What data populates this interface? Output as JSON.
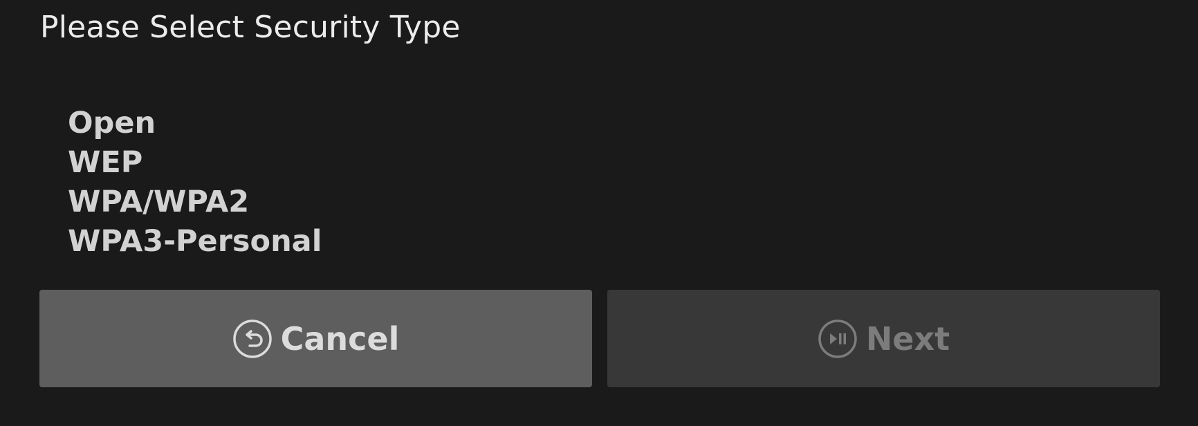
{
  "dialog": {
    "title": "Please Select Security Type",
    "security_options": [
      {
        "label": "Open"
      },
      {
        "label": "WEP"
      },
      {
        "label": "WPA/WPA2"
      },
      {
        "label": "WPA3-Personal"
      }
    ],
    "buttons": {
      "cancel": {
        "label": "Cancel",
        "icon": "back-arrow-circle-icon",
        "state": "focused"
      },
      "next": {
        "label": "Next",
        "icon": "play-pause-circle-icon",
        "state": "disabled"
      }
    }
  },
  "colors": {
    "background": "#1a1a1a",
    "cancel_button": "#5e5e5e",
    "next_button": "#383838",
    "text_primary": "#ececec",
    "text_disabled": "#7c7c7c"
  }
}
